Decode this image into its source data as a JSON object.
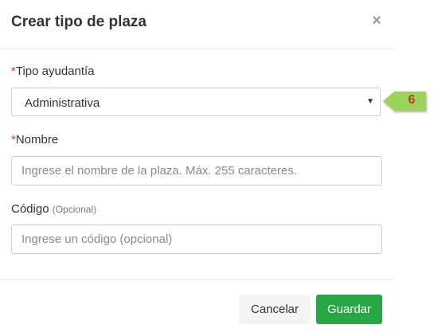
{
  "modal": {
    "title": "Crear tipo de plaza",
    "close_label": "×"
  },
  "form": {
    "tipo_ayudantia": {
      "required_mark": "*",
      "label": "Tipo ayudantía",
      "selected_value": "Administrativa"
    },
    "nombre": {
      "required_mark": "*",
      "label": "Nombre",
      "placeholder": "Ingrese el nombre de la plaza. Máx. 255 caracteres."
    },
    "codigo": {
      "label": "Código",
      "optional_note": "(Opcional)",
      "placeholder": "Ingrese un código (opcional)"
    }
  },
  "callout": {
    "number": "6",
    "color": "#9bd45a"
  },
  "footer": {
    "cancel_label": "Cancelar",
    "save_label": "Guardar"
  },
  "colors": {
    "primary_button": "#28a745",
    "required": "#d9302c"
  }
}
